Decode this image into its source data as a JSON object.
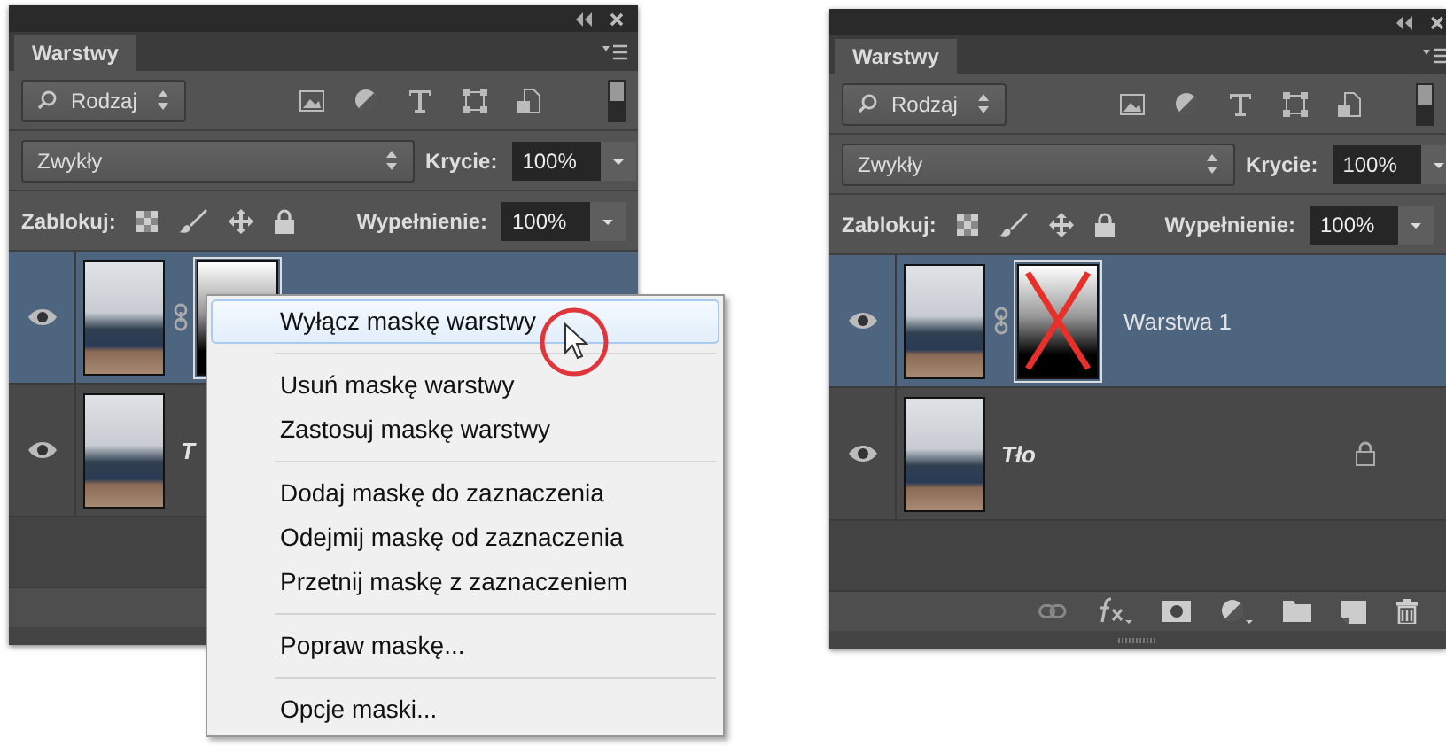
{
  "panels": [
    {
      "tab": "Warstwy",
      "filter": "Rodzaj",
      "blend_mode": "Zwykły",
      "opacity_label": "Krycie:",
      "opacity": "100%",
      "lock_label": "Zablokuj:",
      "fill_label": "Wypełnienie:",
      "fill": "100%",
      "tools_shown": false,
      "layers": [
        {
          "visible": true,
          "selected": true,
          "has_mask": true,
          "mask_disabled": false
        },
        {
          "kind": "background",
          "name": "T",
          "visible": true,
          "selected": false,
          "has_mask": false
        }
      ]
    },
    {
      "tab": "Warstwy",
      "filter": "Rodzaj",
      "blend_mode": "Zwykły",
      "opacity_label": "Krycie:",
      "opacity": "100%",
      "lock_label": "Zablokuj:",
      "fill_label": "Wypełnienie:",
      "fill": "100%",
      "tools_shown": true,
      "layers": [
        {
          "kind": "layer",
          "name": "Warstwa 1",
          "visible": true,
          "selected": true,
          "has_mask": true,
          "mask_disabled": true
        },
        {
          "kind": "background",
          "name": "Tło",
          "visible": true,
          "selected": false,
          "has_mask": false,
          "locked": true
        }
      ]
    }
  ],
  "context_menu": {
    "groups": [
      [
        {
          "label": "Wyłącz maskę warstwy",
          "highlighted": true
        }
      ],
      [
        {
          "label": "Usuń maskę warstwy",
          "highlighted": false
        },
        {
          "label": "Zastosuj maskę warstwy",
          "highlighted": false
        }
      ],
      [
        {
          "label": "Dodaj maskę do zaznaczenia",
          "highlighted": false
        },
        {
          "label": "Odejmij maskę od zaznaczenia",
          "highlighted": false
        },
        {
          "label": "Przetnij maskę z zaznaczeniem",
          "highlighted": false
        }
      ],
      [
        {
          "label": "Popraw maskę...",
          "highlighted": false
        }
      ],
      [
        {
          "label": "Opcje maski...",
          "highlighted": false
        }
      ]
    ]
  }
}
